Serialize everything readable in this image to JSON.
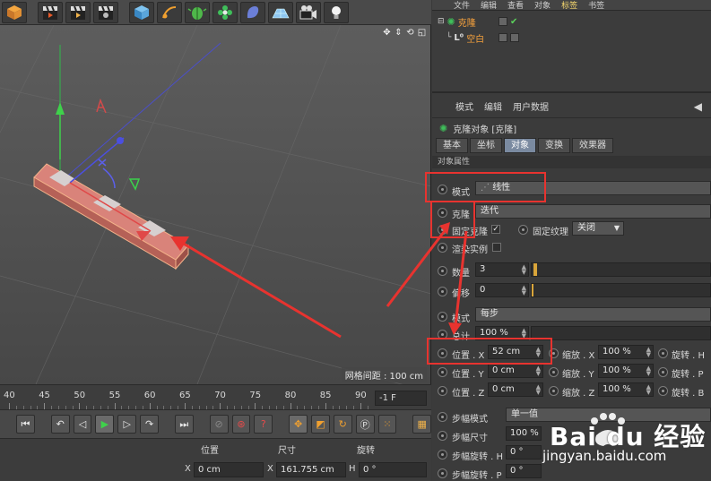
{
  "menus": {
    "object_manager": [
      "文件",
      "编辑",
      "查看",
      "对象",
      "标签",
      "书签"
    ],
    "object_manager_active": 4
  },
  "objects": [
    {
      "name": "克隆",
      "type": "cloner"
    },
    {
      "name": "空白",
      "type": "null"
    }
  ],
  "viewport": {
    "grid_spacing": "网格间距 : 100 cm"
  },
  "timeline": {
    "ticks": [
      "40",
      "45",
      "50",
      "55",
      "60",
      "65",
      "70",
      "75",
      "80",
      "85",
      "90"
    ],
    "current_frame": "-1 F"
  },
  "coords": {
    "headers": {
      "position": "位置",
      "size": "尺寸",
      "rotation": "旋转"
    },
    "x_axis": "X",
    "position_x": "0 cm",
    "size_x": "161.755 cm",
    "rotation_axis": "H",
    "rotation_h": "0 °"
  },
  "attributes": {
    "menu": [
      "模式",
      "编辑",
      "用户数据"
    ],
    "title": "克隆对象 [克隆]",
    "tabs": [
      "基本",
      "坐标",
      "对象",
      "变换",
      "效果器"
    ],
    "active_tab": 2,
    "section": "对象属性",
    "mode_label": "模式",
    "mode_value": "线性",
    "clones_label": "克隆",
    "clones_value": "迭代",
    "fix_clone_label": "固定克隆",
    "fix_texture_label": "固定纹理",
    "fix_texture_value": "关闭",
    "render_instances_label": "渲染实例",
    "count_label": "数量",
    "count_value": "3",
    "offset_label": "偏移",
    "offset_value": "0",
    "mode2_label": "模式",
    "mode2_value": "每步",
    "total_label": "总计",
    "total_value": "100 %",
    "pos_x_label": "位置 . X",
    "pos_x_value": "52 cm",
    "pos_y_label": "位置 . Y",
    "pos_y_value": "0 cm",
    "pos_z_label": "位置 . Z",
    "pos_z_value": "0 cm",
    "scale_x_label": "缩放 . X",
    "scale_x_value": "100 %",
    "scale_y_label": "缩放 . Y",
    "scale_y_value": "100 %",
    "scale_z_label": "缩放 . Z",
    "scale_z_value": "100 %",
    "rot_h_label": "旋转 . H",
    "rot_p_label": "旋转 . P",
    "rot_b_label": "旋转 . B",
    "step_mode_label": "步幅模式",
    "step_mode_value": "单一值",
    "step_size_label": "步幅尺寸",
    "step_size_value": "100 %",
    "step_rot_h_label": "步幅旋转 . H",
    "step_rot_h_value": "0 °",
    "step_rot_p_label": "步幅旋转 . P",
    "step_rot_p_value": "0 °"
  },
  "watermark": {
    "brand": "Bai du 经验",
    "url": "jingyan.baidu.com"
  },
  "icons": [
    "cube-icon",
    "clapper-icon",
    "pen-icon",
    "bug-icon",
    "flower-icon",
    "deform-icon",
    "floor-icon",
    "camera-icon",
    "light-icon"
  ],
  "colors": {
    "highlight": "#e8332f",
    "object_orange": "#f7a23c",
    "active_tab": "#7a8aa0"
  }
}
